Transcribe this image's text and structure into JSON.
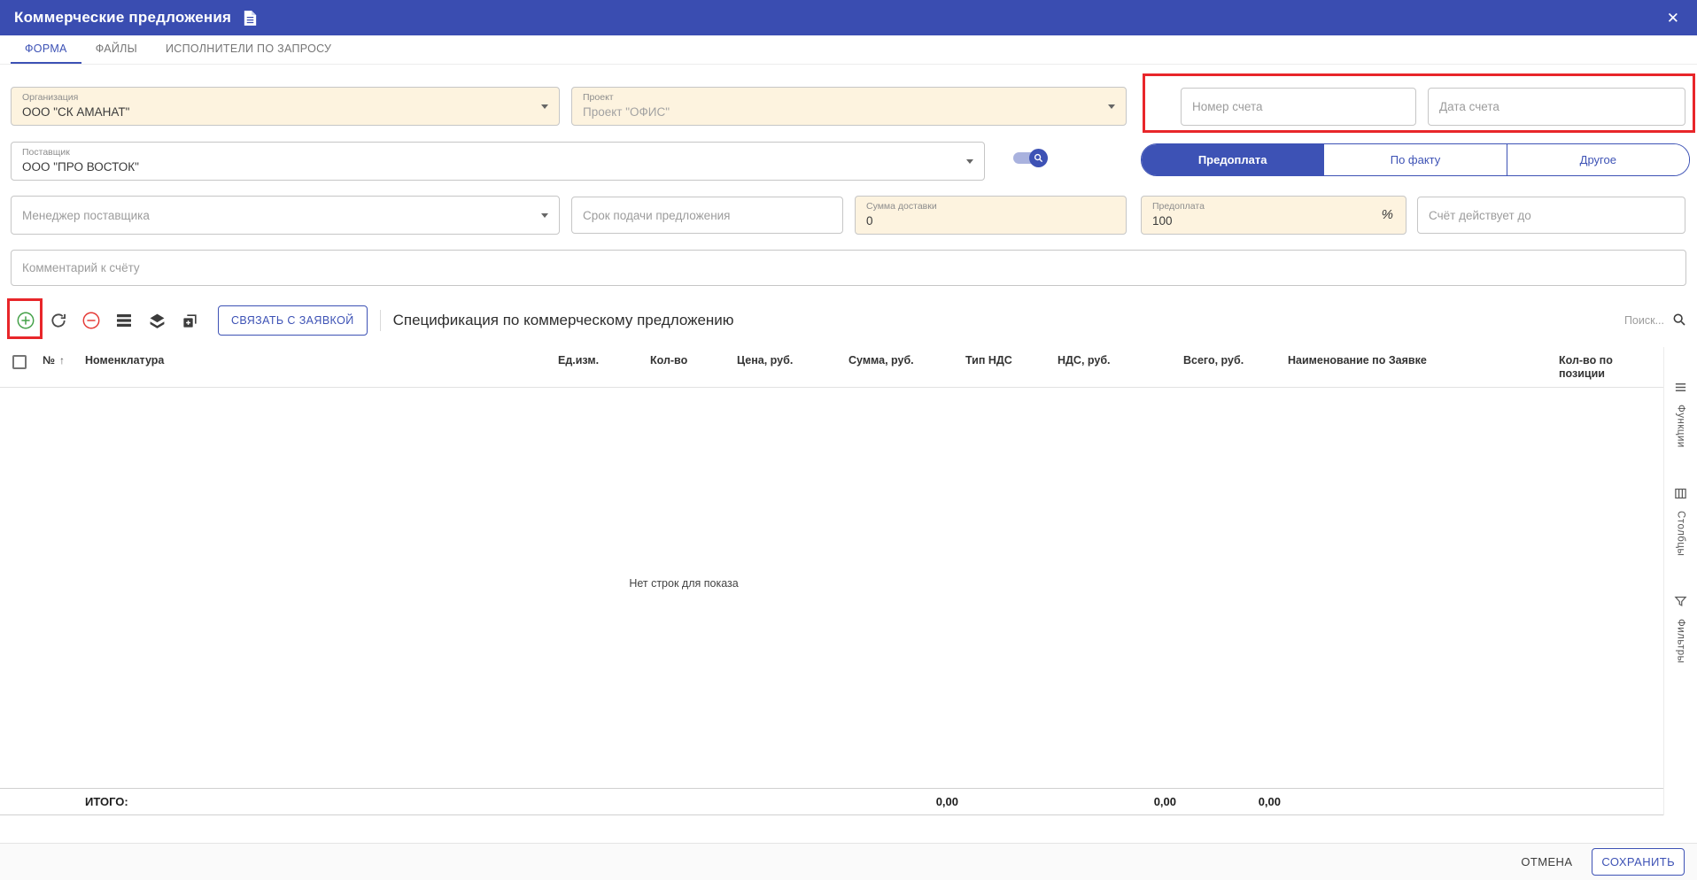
{
  "window": {
    "title": "Коммерческие предложения",
    "close_label": "✕"
  },
  "tabs": {
    "form": "ФОРМА",
    "files": "ФАЙЛЫ",
    "executors": "ИСПОЛНИТЕЛИ ПО ЗАПРОСУ"
  },
  "form": {
    "organization": {
      "label": "Организация",
      "value": "ООО \"СК АМАНАТ\""
    },
    "project": {
      "label": "Проект",
      "value": "Проект \"ОФИС\""
    },
    "invoice_number": {
      "placeholder": "Номер счета"
    },
    "invoice_date": {
      "placeholder": "Дата счета"
    },
    "supplier": {
      "label": "Поставщик",
      "value": "ООО \"ПРО ВОСТОК\""
    },
    "payment_tabs": {
      "prepayment": "Предоплата",
      "on_fact": "По факту",
      "other": "Другое"
    },
    "manager": {
      "placeholder": "Менеджер поставщика"
    },
    "deadline": {
      "placeholder": "Срок подачи предложения"
    },
    "delivery_sum": {
      "label": "Сумма доставки",
      "value": "0"
    },
    "prepayment_percent": {
      "label": "Предоплата",
      "value": "100",
      "suffix": "%"
    },
    "valid_until": {
      "placeholder": "Счёт действует до"
    },
    "comment": {
      "placeholder": "Комментарий к счёту"
    }
  },
  "toolbar": {
    "link_button": "СВЯЗАТЬ С ЗАЯВКОЙ",
    "title": "Спецификация по коммерческому предложению",
    "search": "Поиск..."
  },
  "table": {
    "sort_indicator": "↑",
    "columns": [
      "№",
      "Номенклатура",
      "Ед.изм.",
      "Кол-во",
      "Цена, руб.",
      "Сумма, руб.",
      "Тип НДС",
      "НДС, руб.",
      "Всего, руб.",
      "Наименование по Заявке",
      "Кол-во по позиции"
    ],
    "empty": "Нет строк для показа",
    "totals": {
      "label": "ИТОГО:",
      "sum": "0,00",
      "vat": "0,00",
      "total": "0,00"
    }
  },
  "side_panel": {
    "functions": "Функции",
    "columns": "Столбцы",
    "filters": "Фильтры"
  },
  "actions": {
    "cancel": "ОТМЕНА",
    "save": "СОХРАНИТЬ"
  },
  "colors": {
    "accent": "#3d52b5",
    "header_bg": "#3a4db1",
    "filled_field_bg": "#fdf3df",
    "annotation_red": "#e8262a",
    "add_green": "#43a047",
    "remove_red": "#e53935"
  }
}
